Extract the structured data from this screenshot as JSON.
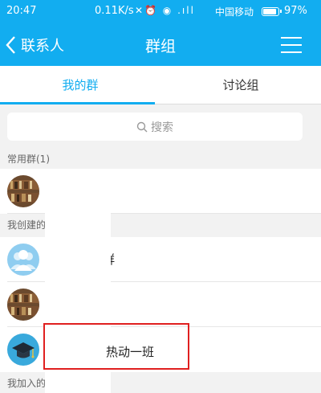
{
  "statusbar": {
    "time": "20:47",
    "net_speed": "0.11K/s",
    "icons": "✕⏰ ◉ .ıll",
    "carrier": "中国移动",
    "battery_text": "97%",
    "battery_level": 0.97
  },
  "header": {
    "back_label": "联系人",
    "title": "群组"
  },
  "tabs": [
    {
      "label": "我的群"
    },
    {
      "label": "讨论组"
    }
  ],
  "search": {
    "placeholder": "搜索"
  },
  "sections": {
    "frequent": "常用群(1)",
    "created": "我创建的",
    "joined": "我加入的"
  },
  "rows": {
    "group_suffix": "群",
    "highlight_name": "热动一班"
  },
  "colors": {
    "accent": "#12adf0",
    "highlight": "#e02020"
  }
}
